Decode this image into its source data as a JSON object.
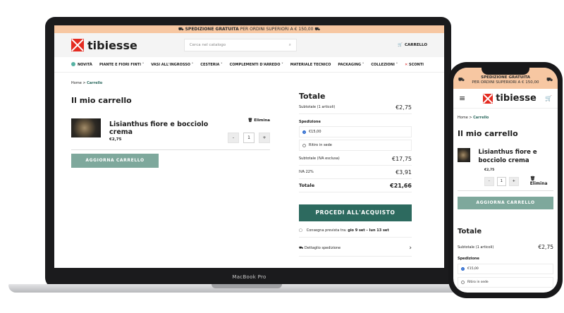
{
  "promo": {
    "bold": "SPEDIZIONE GRATUITA",
    "rest": " PER ORDINI SUPERIORI A € 150,00",
    "rest_mobile": "PER ORDINI SUPERIORI A € 150,00"
  },
  "brand": {
    "name": "tibiesse"
  },
  "search": {
    "placeholder": "Cerca nel catalogo"
  },
  "cart_label": "CARRELLO",
  "cart_count": "1",
  "nav": [
    "NOVITÀ",
    "PIANTE E FIORI FINTI ˅",
    "VASI ALL'INGROSSO ˅",
    "CESTERIA ˅",
    "COMPLEMENTI D'ARREDO ˅",
    "MATERIALE TECNICO",
    "PACKAGING ˅",
    "COLLEZIONI ˅",
    "SCONTI"
  ],
  "breadcrumb": {
    "home": "Home",
    "sep": " > ",
    "current": "Carrello"
  },
  "cart": {
    "title": "Il mio carrello",
    "item": {
      "name": "Lisianthus fiore e bocciolo crema",
      "price": "€2,75",
      "quantity": "1"
    },
    "delete_label": "Elimina",
    "qty_minus": "-",
    "qty_plus": "+",
    "update_button": "AGGIORNA CARRELLO"
  },
  "totals": {
    "title": "Totale",
    "subtotal_label": "Subtotale (1 articoli)",
    "subtotal_value": "€2,75",
    "shipping_label": "Spedizione",
    "shipping_option_1": "€15,00",
    "shipping_option_2": "Ritiro in sede",
    "subtotal_ex_label": "Subtotale (IVA esclusa)",
    "subtotal_ex_value": "€17,75",
    "vat_label": "IVA 22%",
    "vat_value": "€3,91",
    "total_label": "Totale",
    "total_value": "€21,66",
    "checkout_button": "PROCEDI ALL'ACQUISTO",
    "delivery_prefix": "Consegna prevista tra: ",
    "delivery_dates": "gio 9 set – lun 13 set",
    "shipping_detail": "Dettaglio spedizione",
    "chevron": "›"
  },
  "device": {
    "laptop_label": "MacBook Pro"
  },
  "icons": {
    "delete": "trash-icon",
    "search": "search-icon",
    "cart": "cart-icon",
    "truck": "truck-icon",
    "menu": "hamburger-icon"
  },
  "colors": {
    "promo_bg": "#f7c7a2",
    "accent": "#2d6a5f",
    "update_btn": "#7ea89c",
    "brand_red": "#e42b21"
  }
}
